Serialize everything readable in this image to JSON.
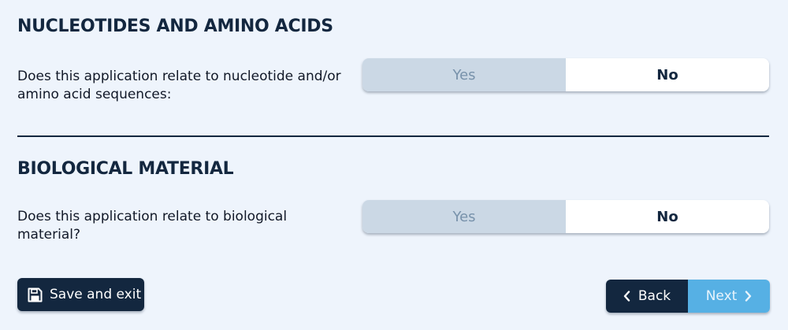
{
  "sections": [
    {
      "heading": "NUCLEOTIDES AND AMINO ACIDS",
      "question": "Does this application relate to nucleotide and/or amino acid sequences:",
      "yes_label": "Yes",
      "no_label": "No"
    },
    {
      "heading": "BIOLOGICAL MATERIAL",
      "question": "Does this application relate to biological material?",
      "yes_label": "Yes",
      "no_label": "No"
    }
  ],
  "footer": {
    "save_label": "Save and exit",
    "back_label": "Back",
    "next_label": "Next"
  },
  "colors": {
    "background": "#eef4fc",
    "primary_dark": "#13273f",
    "accent_blue": "#56b0e4",
    "toggle_inactive": "#cbd8e5"
  },
  "icons": {
    "save": "floppy-disk-icon",
    "back": "chevron-left-icon",
    "next": "chevron-right-icon"
  }
}
